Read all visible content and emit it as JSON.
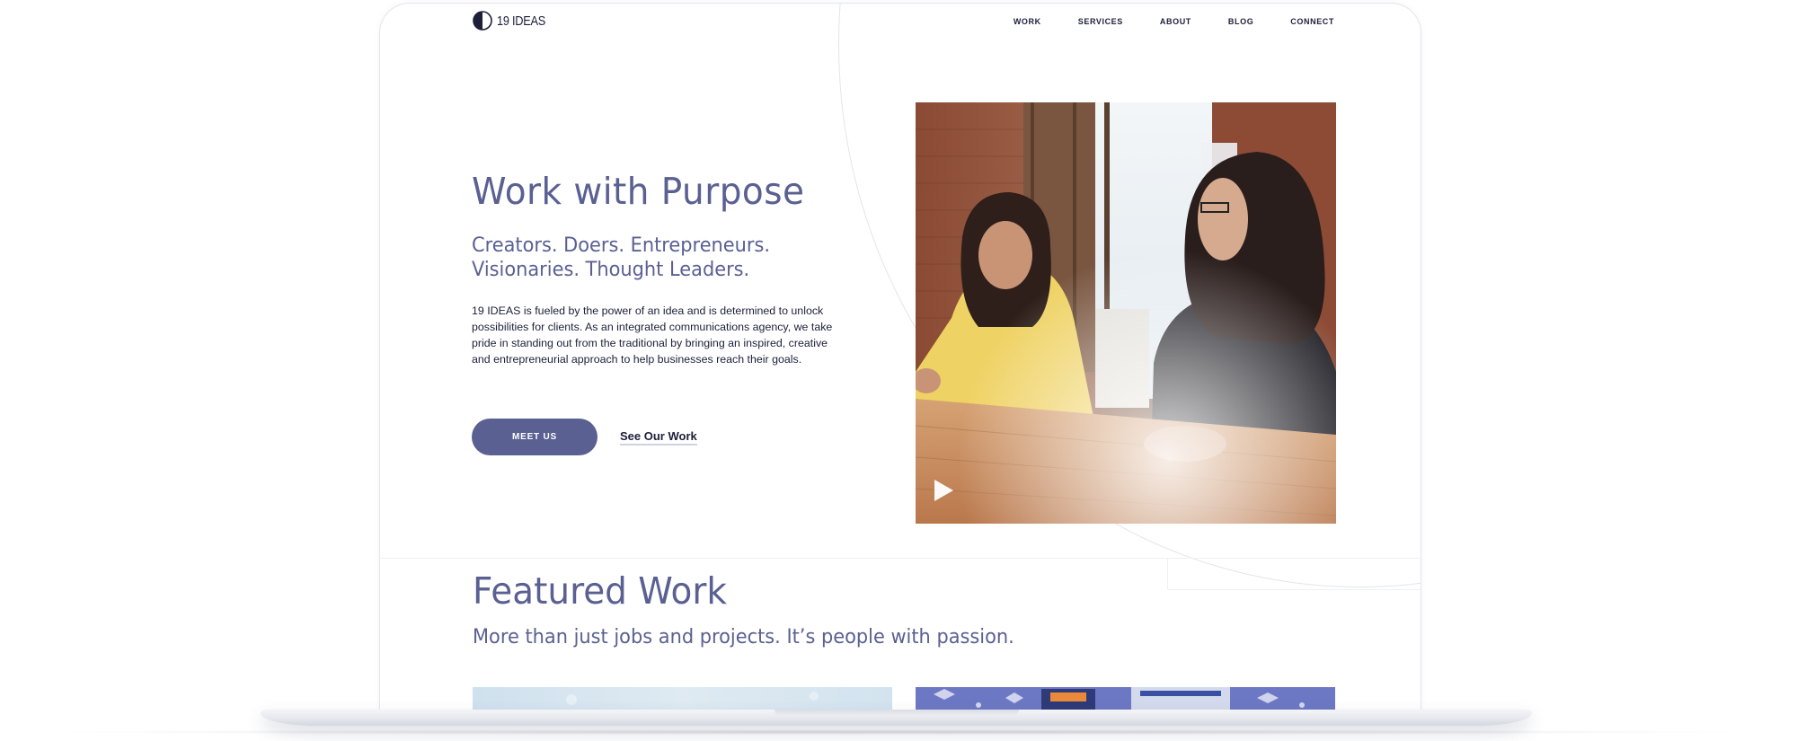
{
  "logo": {
    "text": "19 IDEAS"
  },
  "nav": {
    "items": [
      {
        "label": "WORK"
      },
      {
        "label": "SERVICES"
      },
      {
        "label": "ABOUT"
      },
      {
        "label": "BLOG"
      },
      {
        "label": "CONNECT"
      }
    ]
  },
  "hero": {
    "title": "Work with Purpose",
    "subtitle_line1": "Creators. Doers. Entrepreneurs.",
    "subtitle_line2": "Visionaries. Thought Leaders.",
    "body": "19 IDEAS is fueled by the power of an idea and is determined to unlock possibilities for clients. As an integrated communications agency, we take pride in standing out from the traditional by bringing an inspired, creative and entrepreneurial approach to help businesses reach their goals.",
    "primary_button": "MEET US",
    "secondary_link": "See Our Work"
  },
  "video": {
    "icon": "play-icon"
  },
  "featured": {
    "title": "Featured Work",
    "subtitle": "More than just jobs and projects. It’s people with passion."
  },
  "colors": {
    "accent": "#5a6092",
    "text_dark": "#1d1f3a",
    "card_purple": "#6d78c4"
  }
}
